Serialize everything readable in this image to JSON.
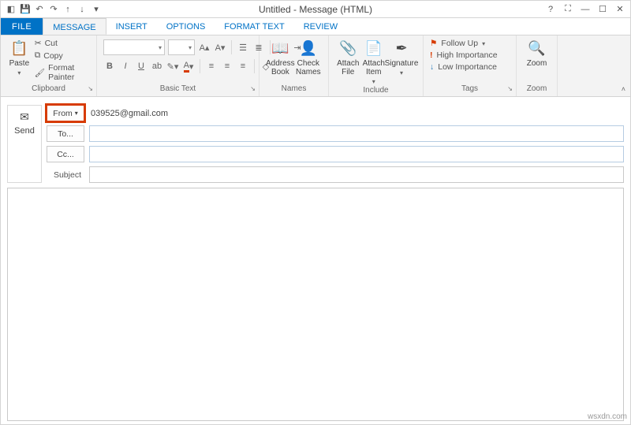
{
  "title": "Untitled - Message (HTML)",
  "qat": {
    "app_icon": "outlook-icon",
    "save": "💾",
    "undo": "↶",
    "redo": "↷",
    "up": "↑",
    "down": "↓"
  },
  "tabs": [
    "FILE",
    "MESSAGE",
    "INSERT",
    "OPTIONS",
    "FORMAT TEXT",
    "REVIEW"
  ],
  "ribbon": {
    "clipboard": {
      "paste": "Paste",
      "cut": "Cut",
      "copy": "Copy",
      "format_painter": "Format Painter",
      "title": "Clipboard"
    },
    "basic_text": {
      "font": "",
      "size": "",
      "title": "Basic Text"
    },
    "names": {
      "address_book": "Address\nBook",
      "check_names": "Check\nNames",
      "title": "Names"
    },
    "include": {
      "attach_file": "Attach\nFile",
      "attach_item": "Attach\nItem",
      "signature": "Signature",
      "title": "Include"
    },
    "tags": {
      "follow_up": "Follow Up",
      "high": "High Importance",
      "low": "Low Importance",
      "title": "Tags"
    },
    "zoom": {
      "zoom": "Zoom",
      "title": "Zoom"
    }
  },
  "compose": {
    "send": "Send",
    "from_label": "From",
    "from_value": "039525@gmail.com",
    "to_label": "To...",
    "cc_label": "Cc...",
    "subject_label": "Subject"
  },
  "watermark": "wsxdn.com"
}
